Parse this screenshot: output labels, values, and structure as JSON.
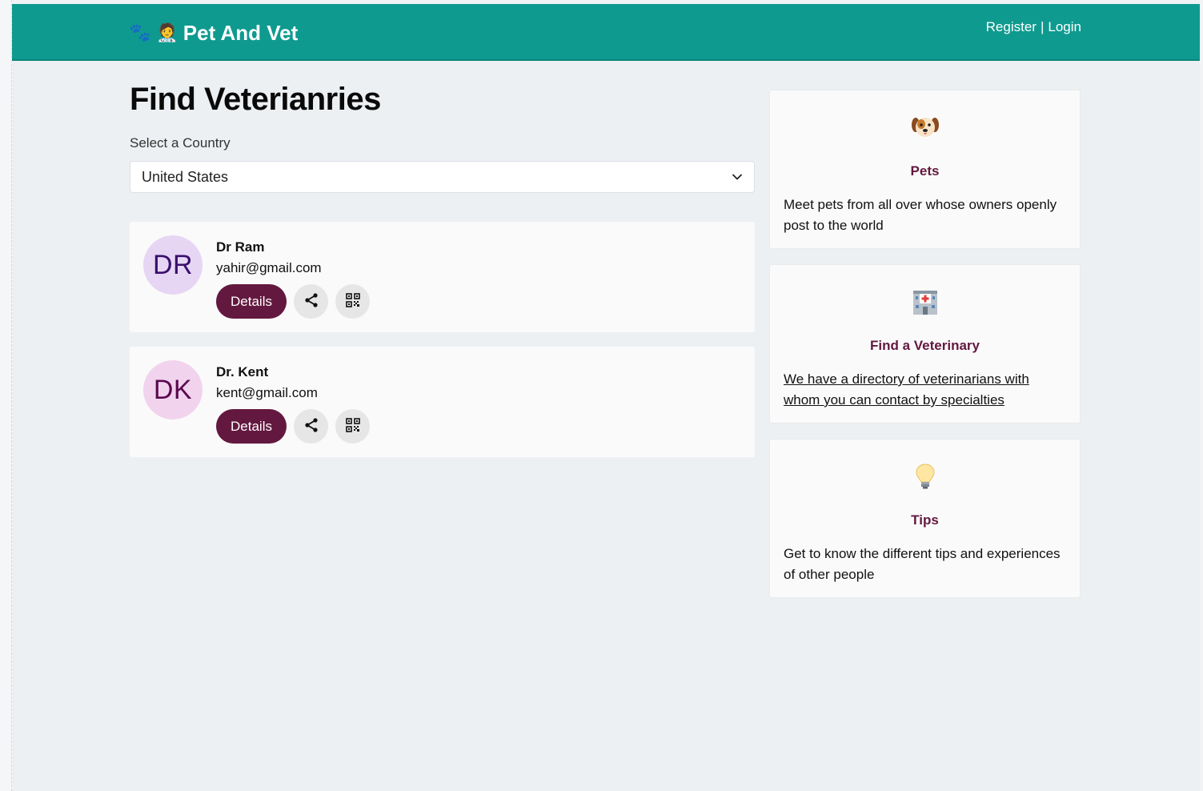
{
  "header": {
    "brand_emojis": "🐾 🧑‍⚕️",
    "brand_name": "Pet And Vet",
    "register_label": "Register",
    "separator": "|",
    "login_label": "Login",
    "bg_color": "#0e9a8f"
  },
  "main": {
    "title": "Find Veterianries",
    "country_label": "Select a Country",
    "country_selected": "United States"
  },
  "vets": [
    {
      "initials": "DR",
      "name": "Dr Ram",
      "email": "yahir@gmail.com",
      "details_label": "Details",
      "avatar_bg": "#e6d6f4",
      "avatar_color": "#3a0f6e"
    },
    {
      "initials": "DK",
      "name": "Dr. Kent",
      "email": "kent@gmail.com",
      "details_label": "Details",
      "avatar_bg": "#f2d3ee",
      "avatar_color": "#5a0a4e"
    }
  ],
  "features": [
    {
      "icon": "dog-face-icon",
      "title": "Pets",
      "desc": "Meet pets from all over whose owners openly post to the world"
    },
    {
      "icon": "hospital-icon",
      "title": "Find a Veterinary",
      "desc": "We have a directory of veterinarians with whom you can contact by specialties"
    },
    {
      "icon": "lightbulb-icon",
      "title": "Tips",
      "desc": "Get to know the different tips and experiences of other people"
    }
  ],
  "colors": {
    "accent": "#63183f",
    "icon_button_bg": "#e6e6e6"
  }
}
